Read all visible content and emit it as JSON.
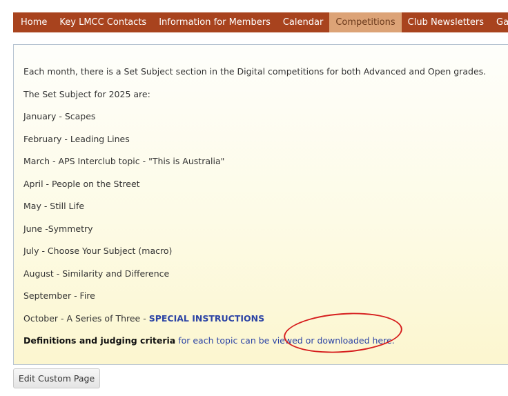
{
  "nav": {
    "items": [
      {
        "label": "Home"
      },
      {
        "label": "Key LMCC Contacts"
      },
      {
        "label": "Information for Members"
      },
      {
        "label": "Calendar"
      },
      {
        "label": "Competitions"
      },
      {
        "label": "Club Newsletters"
      },
      {
        "label": "Galleries"
      }
    ],
    "active": "Competitions",
    "colors": {
      "bar": "#a8431e",
      "active": "#dca377"
    }
  },
  "content": {
    "intro": "Each month, there is a Set Subject section in the Digital competitions for both Advanced and Open grades.",
    "subtitle": "The Set Subject for 2025 are:",
    "subjects": [
      "January - Scapes",
      "February - Leading Lines",
      "March - APS Interclub topic - \"This is Australia\"",
      "April - People on the Street",
      "May - Still Life",
      "June -Symmetry",
      "July - Choose Your Subject (macro)",
      "August - Similarity and Difference",
      "September - Fire"
    ],
    "october": {
      "text": "October - A Series of Three - ",
      "link": "SPECIAL INSTRUCTIONS"
    },
    "definitions": {
      "bold": "Definitions and judging criteria",
      "link": " for each topic can be viewed or downloaded here."
    },
    "link_color": "#2c44a5"
  },
  "annotation": {
    "color": "#d61e1e"
  },
  "footer": {
    "edit_button": "Edit Custom Page"
  }
}
